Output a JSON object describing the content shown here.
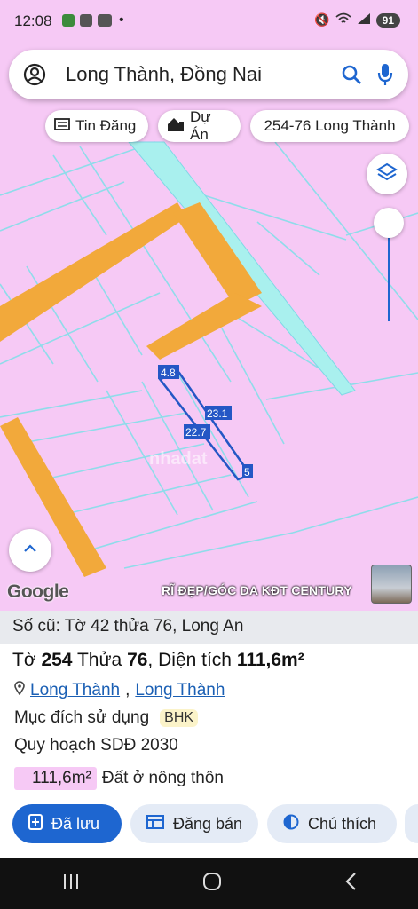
{
  "status": {
    "time": "12:08",
    "battery": "91"
  },
  "search": {
    "query": "Long Thành, Đồng Nai"
  },
  "chips": {
    "listing": "Tin Đăng",
    "project": "Dự Án",
    "parcel": "254-76 Long Thành"
  },
  "map": {
    "dim_top": "4.8",
    "dim_right": "23.1",
    "dim_left": "22.7",
    "dim_bottom": "5",
    "watermark": "nhadat",
    "google": "Google",
    "ad_label": "RĨ ĐẸP/GÓC DA KĐT CENTURY"
  },
  "panel": {
    "old_info": "Số cũ: Tờ 42 thửa 76, Long An",
    "to_label": "Tờ",
    "to_value": "254",
    "thua_label": "Thửa",
    "thua_value": "76",
    "area_label": "Diện tích",
    "area_value": "111,6m²",
    "district": "Long Thành",
    "commune": "Long Thành",
    "purpose_label": "Mục đích sử dụng",
    "purpose_code": "BHK",
    "plan_label": "Quy hoạch SDĐ 2030",
    "zone_area": "111,6m²",
    "zone_name": "Đất ở nông thôn"
  },
  "actions": {
    "saved": "Đã lưu",
    "sell": "Đăng bán",
    "legend": "Chú thích"
  },
  "colors": {
    "land": "#f6c9f5",
    "road": "#f2a93b",
    "river": "#a9f0ee",
    "primary": "#1e66d0"
  }
}
